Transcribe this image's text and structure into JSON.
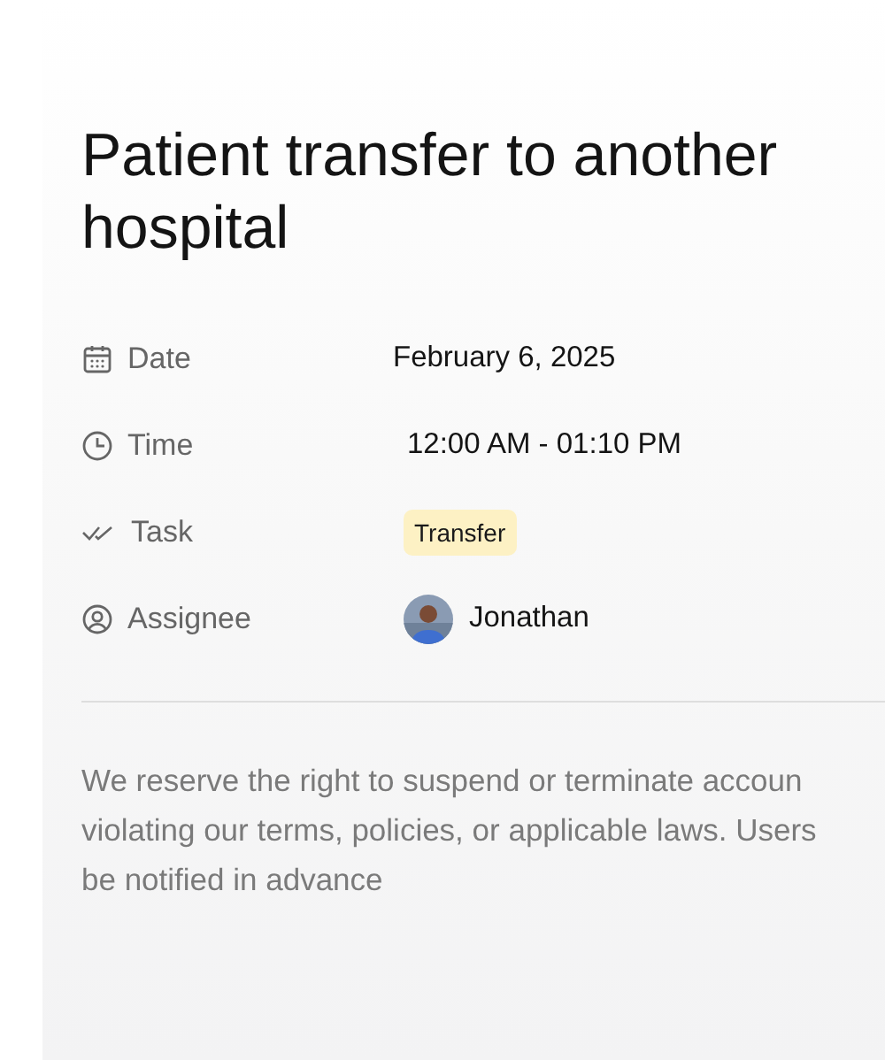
{
  "title": "Patient transfer to another hospital",
  "fields": [
    {
      "kind": "date",
      "label": "Date",
      "value": "February 6, 2025"
    },
    {
      "kind": "time",
      "label": "Time",
      "value": "12:00 AM - 01:10 PM"
    },
    {
      "kind": "task",
      "label": "Task",
      "value": "Transfer"
    },
    {
      "kind": "assignee",
      "label": "Assignee",
      "value": "Jonathan"
    }
  ],
  "note": "We reserve the right to suspend or terminate accoun\nviolating our terms, policies, or applicable laws. Users\nbe notified in advance"
}
